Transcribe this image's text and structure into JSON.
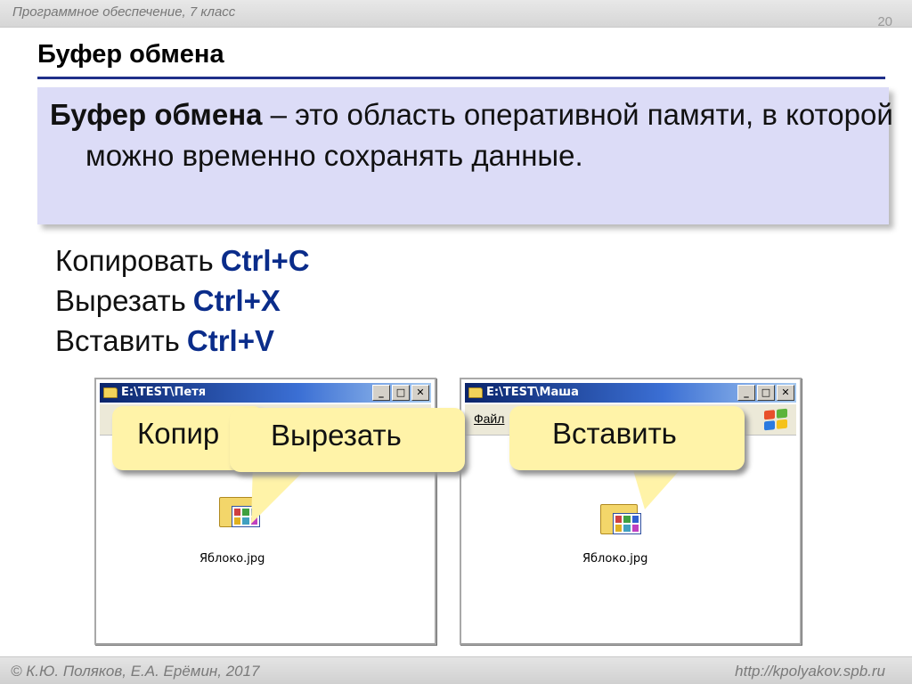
{
  "header": {
    "caption": "Программное обеспечение, 7 класс",
    "slide_number": "20"
  },
  "title": "Буфер обмена",
  "definition": {
    "term": "Буфер обмена",
    "text": " – это область оперативной памяти, в которой можно временно сохранять данные."
  },
  "shortcuts": [
    {
      "action": "Копировать",
      "key": "Ctrl+C"
    },
    {
      "action": "Вырезать",
      "key": "Ctrl+X"
    },
    {
      "action": "Вставить",
      "key": "Ctrl+V"
    }
  ],
  "windows": [
    {
      "title": "E:\\TEST\\Петя",
      "menu_label": "",
      "file_name": "Яблоко.jpg"
    },
    {
      "title": "E:\\TEST\\Маша",
      "menu_label": "Файл",
      "file_name": "Яблоко.jpg"
    }
  ],
  "window_controls": {
    "minimize": "_",
    "maximize": "□",
    "close": "✕"
  },
  "callouts": {
    "copy": "Копир",
    "cut": "Вырезать",
    "paste": "Вставить"
  },
  "footer": {
    "left": "© К.Ю. Поляков, Е.А. Ерёмин, 2017",
    "right": "http://kpolyakov.spb.ru"
  },
  "colors": {
    "title_rule": "#1f2f8a",
    "definition_bg": "#dcdcf7",
    "shortcut_key": "#0a2c8a",
    "callout_bg": "#fff3a8"
  },
  "icons": [
    "folder-icon",
    "minimize-icon",
    "maximize-icon",
    "close-icon",
    "windows-logo-icon",
    "image-file-icon"
  ]
}
